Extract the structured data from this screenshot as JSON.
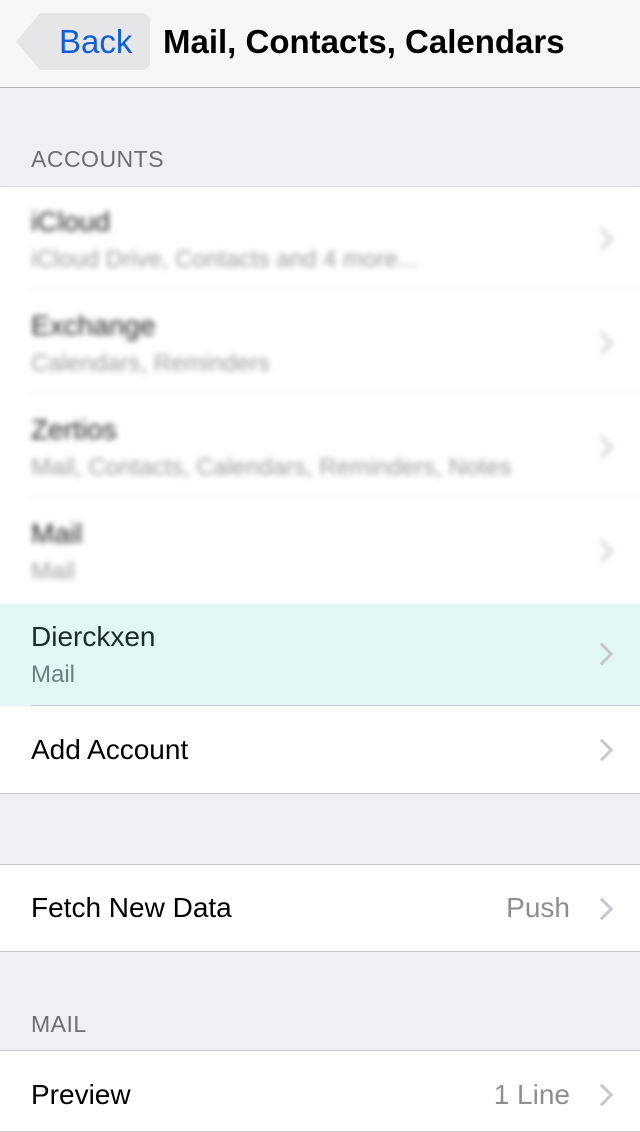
{
  "navbar": {
    "back_label": "Back",
    "title": "Mail, Contacts, Calendars"
  },
  "accounts": {
    "header": "ACCOUNTS",
    "items": [
      {
        "title": "iCloud",
        "subtitle": "iCloud Drive, Contacts and 4 more..."
      },
      {
        "title": "Exchange",
        "subtitle": "Calendars, Reminders"
      },
      {
        "title": "Zertios",
        "subtitle": "Mail, Contacts, Calendars, Reminders, Notes"
      },
      {
        "title": "Mail",
        "subtitle": "Mail"
      },
      {
        "title": "Dierckxen",
        "subtitle": "Mail"
      }
    ],
    "add_account": "Add Account"
  },
  "fetch": {
    "label": "Fetch New Data",
    "value": "Push"
  },
  "mail": {
    "header": "MAIL",
    "preview_label": "Preview",
    "preview_value": "1 Line"
  }
}
